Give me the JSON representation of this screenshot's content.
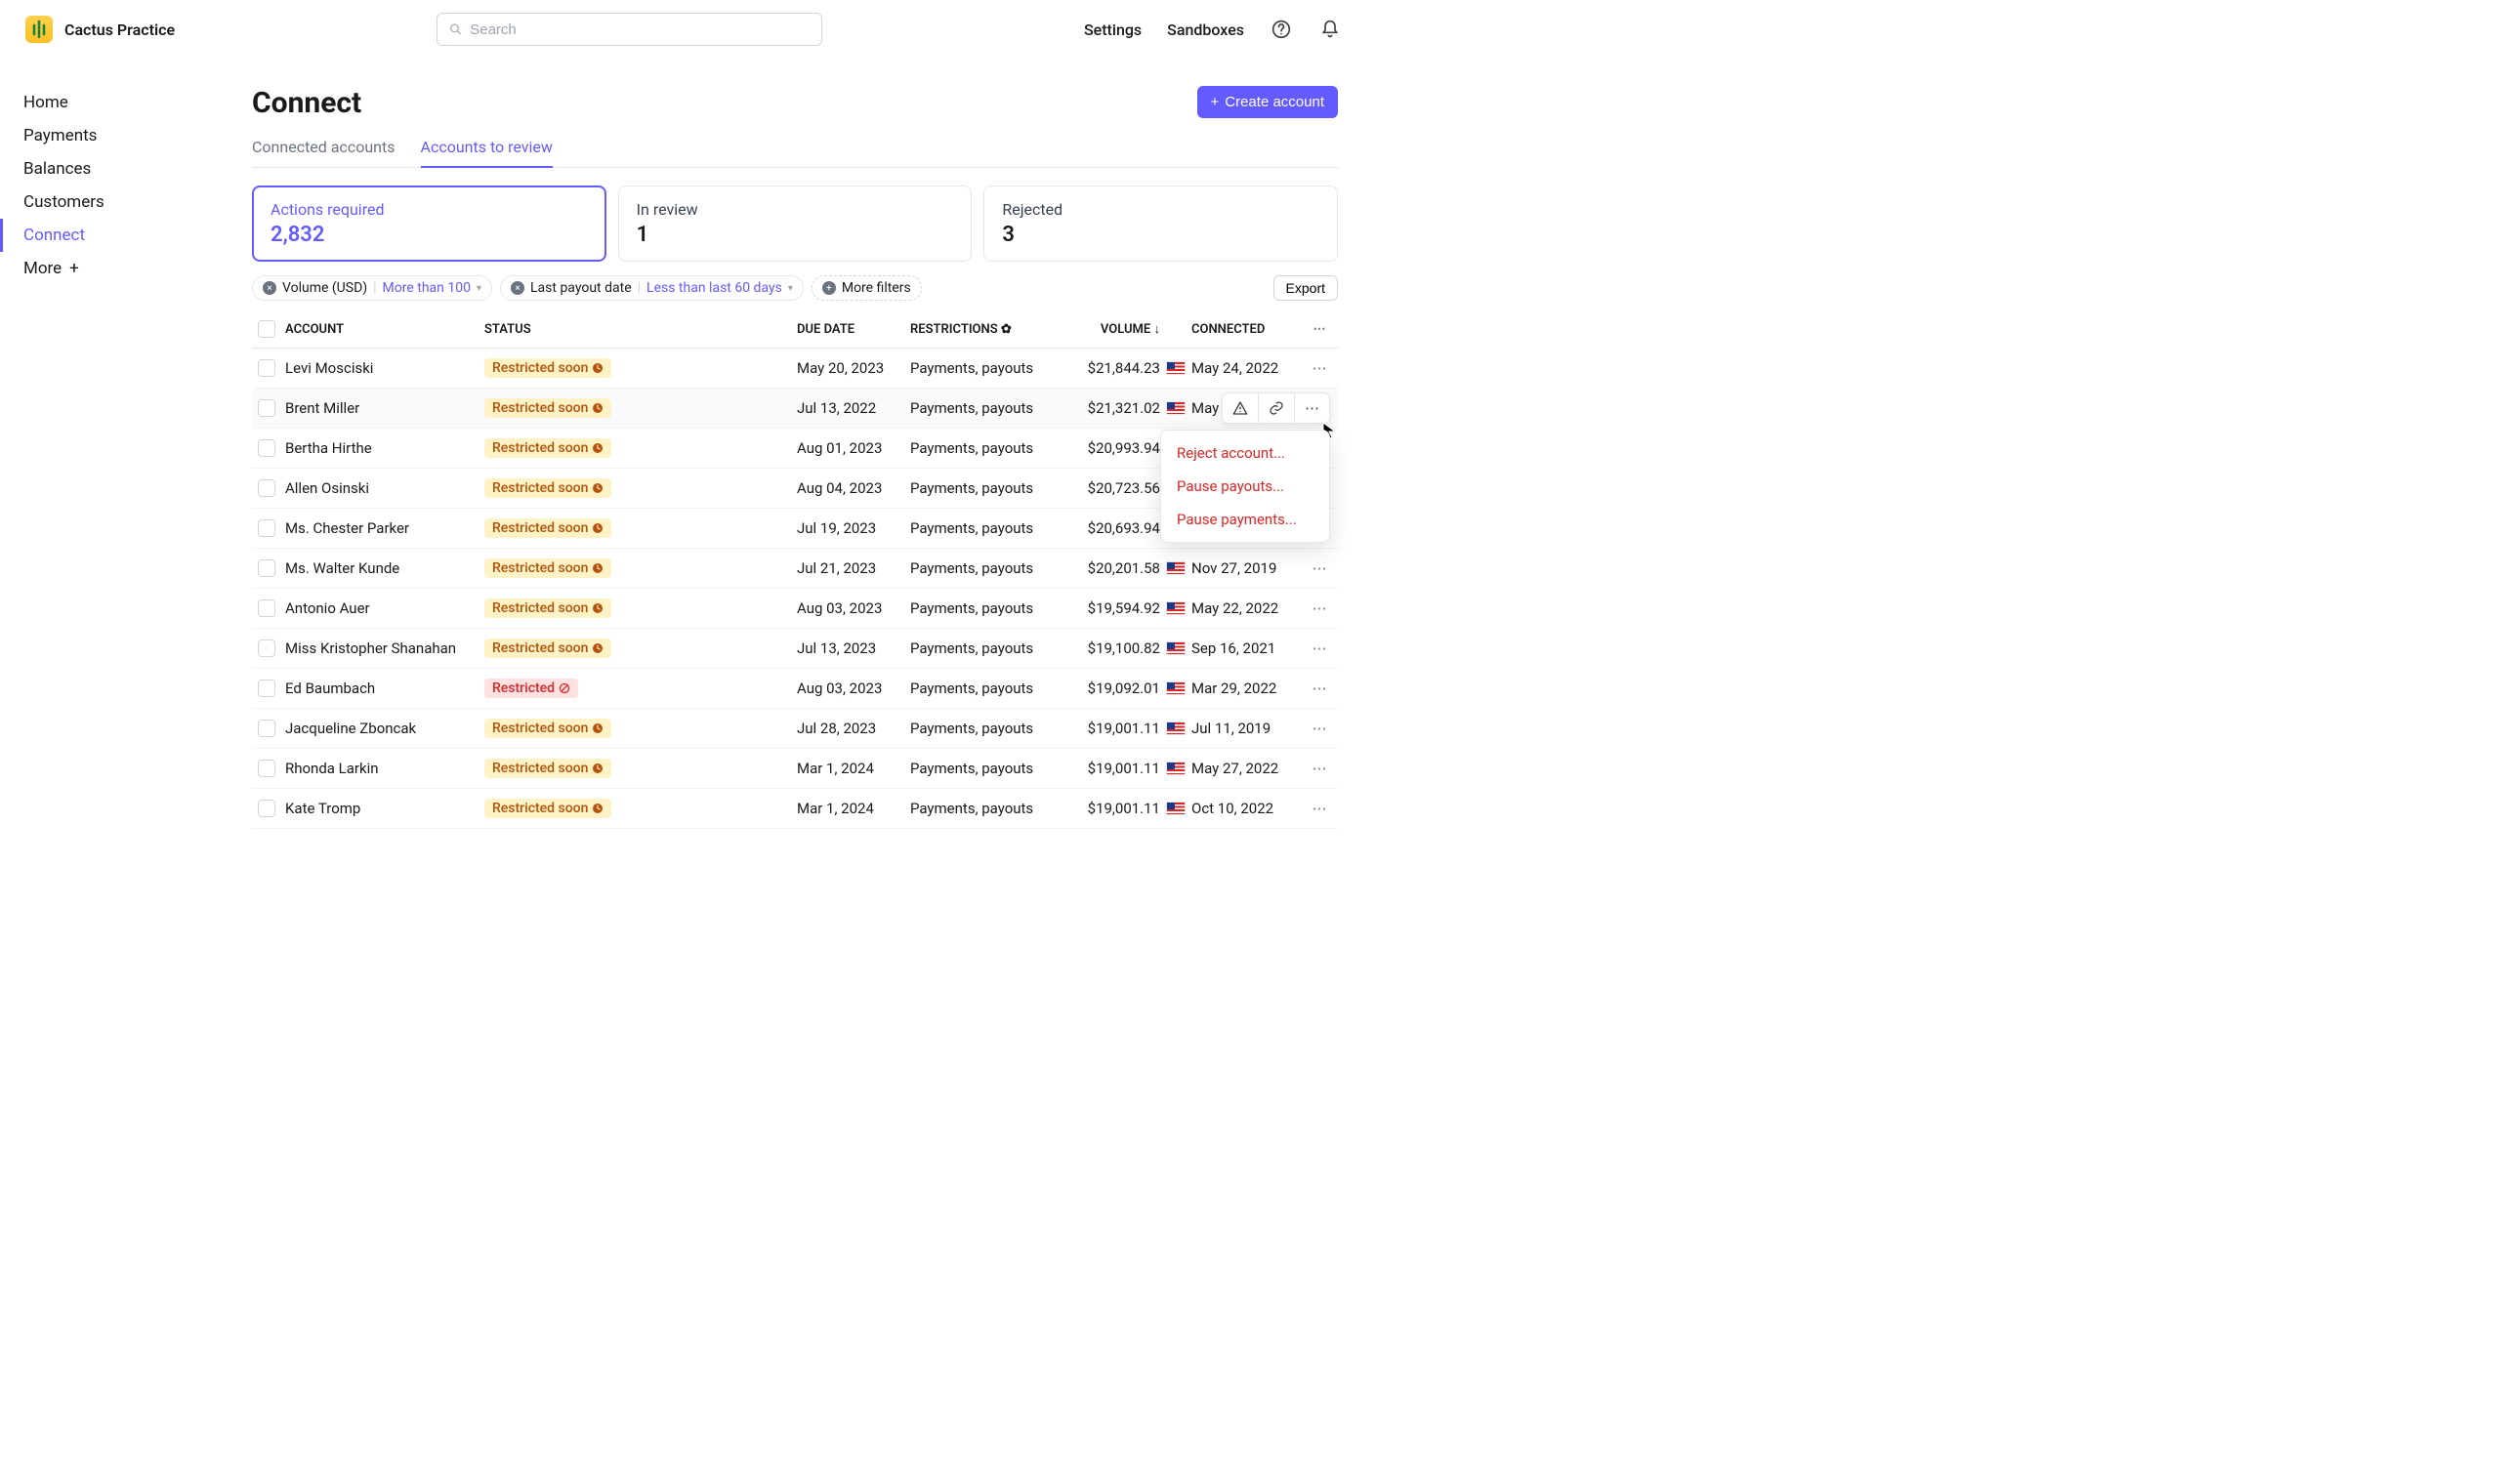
{
  "brand": {
    "name": "Cactus Practice"
  },
  "search": {
    "placeholder": "Search"
  },
  "topnav": {
    "settings": "Settings",
    "sandboxes": "Sandboxes"
  },
  "sidebar": {
    "items": [
      {
        "label": "Home"
      },
      {
        "label": "Payments"
      },
      {
        "label": "Balances"
      },
      {
        "label": "Customers"
      },
      {
        "label": "Connect"
      },
      {
        "label": "More"
      }
    ]
  },
  "page": {
    "title": "Connect"
  },
  "actions": {
    "create": "Create account",
    "export": "Export"
  },
  "tabs": [
    {
      "label": "Connected accounts"
    },
    {
      "label": "Accounts to review"
    }
  ],
  "summary": [
    {
      "label": "Actions required",
      "value": "2,832"
    },
    {
      "label": "In review",
      "value": "1"
    },
    {
      "label": "Rejected",
      "value": "3"
    }
  ],
  "filters": {
    "vol_label": "Volume (USD)",
    "vol_value": "More than 100",
    "payout_label": "Last payout date",
    "payout_value": "Less than last 60 days",
    "more": "More filters"
  },
  "columns": {
    "account": "ACCOUNT",
    "status": "STATUS",
    "due": "DUE DATE",
    "restrictions": "RESTRICTIONS",
    "volume": "VOLUME",
    "connected": "CONNECTED"
  },
  "status_labels": {
    "soon": "Restricted soon",
    "restricted": "Restricted"
  },
  "rows": [
    {
      "account": "Levi Mosciski",
      "status": "soon",
      "due": "May 20, 2023",
      "restrictions": "Payments, payouts",
      "volume": "$21,844.23",
      "connected": "May 24, 2022"
    },
    {
      "account": "Brent Miller",
      "status": "soon",
      "due": "Jul 13, 2022",
      "restrictions": "Payments, payouts",
      "volume": "$21,321.02",
      "connected": "May"
    },
    {
      "account": "Bertha Hirthe",
      "status": "soon",
      "due": "Aug 01, 2023",
      "restrictions": "Payments, payouts",
      "volume": "$20,993.94",
      "connected": ""
    },
    {
      "account": "Allen Osinski",
      "status": "soon",
      "due": "Aug 04, 2023",
      "restrictions": "Payments, payouts",
      "volume": "$20,723.56",
      "connected": ""
    },
    {
      "account": "Ms. Chester Parker",
      "status": "soon",
      "due": "Jul 19, 2023",
      "restrictions": "Payments, payouts",
      "volume": "$20,693.94",
      "connected": ""
    },
    {
      "account": "Ms. Walter Kunde",
      "status": "soon",
      "due": "Jul 21, 2023",
      "restrictions": "Payments, payouts",
      "volume": "$20,201.58",
      "connected": "Nov 27, 2019"
    },
    {
      "account": "Antonio Auer",
      "status": "soon",
      "due": "Aug 03, 2023",
      "restrictions": "Payments, payouts",
      "volume": "$19,594.92",
      "connected": "May 22, 2022"
    },
    {
      "account": "Miss Kristopher Shanahan",
      "status": "soon",
      "due": "Jul 13, 2023",
      "restrictions": "Payments, payouts",
      "volume": "$19,100.82",
      "connected": "Sep 16, 2021"
    },
    {
      "account": "Ed Baumbach",
      "status": "restricted",
      "due": "Aug 03, 2023",
      "restrictions": "Payments, payouts",
      "volume": "$19,092.01",
      "connected": "Mar 29, 2022"
    },
    {
      "account": "Jacqueline Zboncak",
      "status": "soon",
      "due": "Jul 28, 2023",
      "restrictions": "Payments, payouts",
      "volume": "$19,001.11",
      "connected": "Jul 11, 2019"
    },
    {
      "account": "Rhonda Larkin",
      "status": "soon",
      "due": "Mar 1, 2024",
      "restrictions": "Payments, payouts",
      "volume": "$19,001.11",
      "connected": "May 27, 2022"
    },
    {
      "account": "Kate Tromp",
      "status": "soon",
      "due": "Mar 1, 2024",
      "restrictions": "Payments, payouts",
      "volume": "$19,001.11",
      "connected": "Oct 10, 2022"
    }
  ],
  "dropdown": {
    "reject": "Reject account...",
    "pause_payouts": "Pause payouts...",
    "pause_payments": "Pause payments..."
  }
}
